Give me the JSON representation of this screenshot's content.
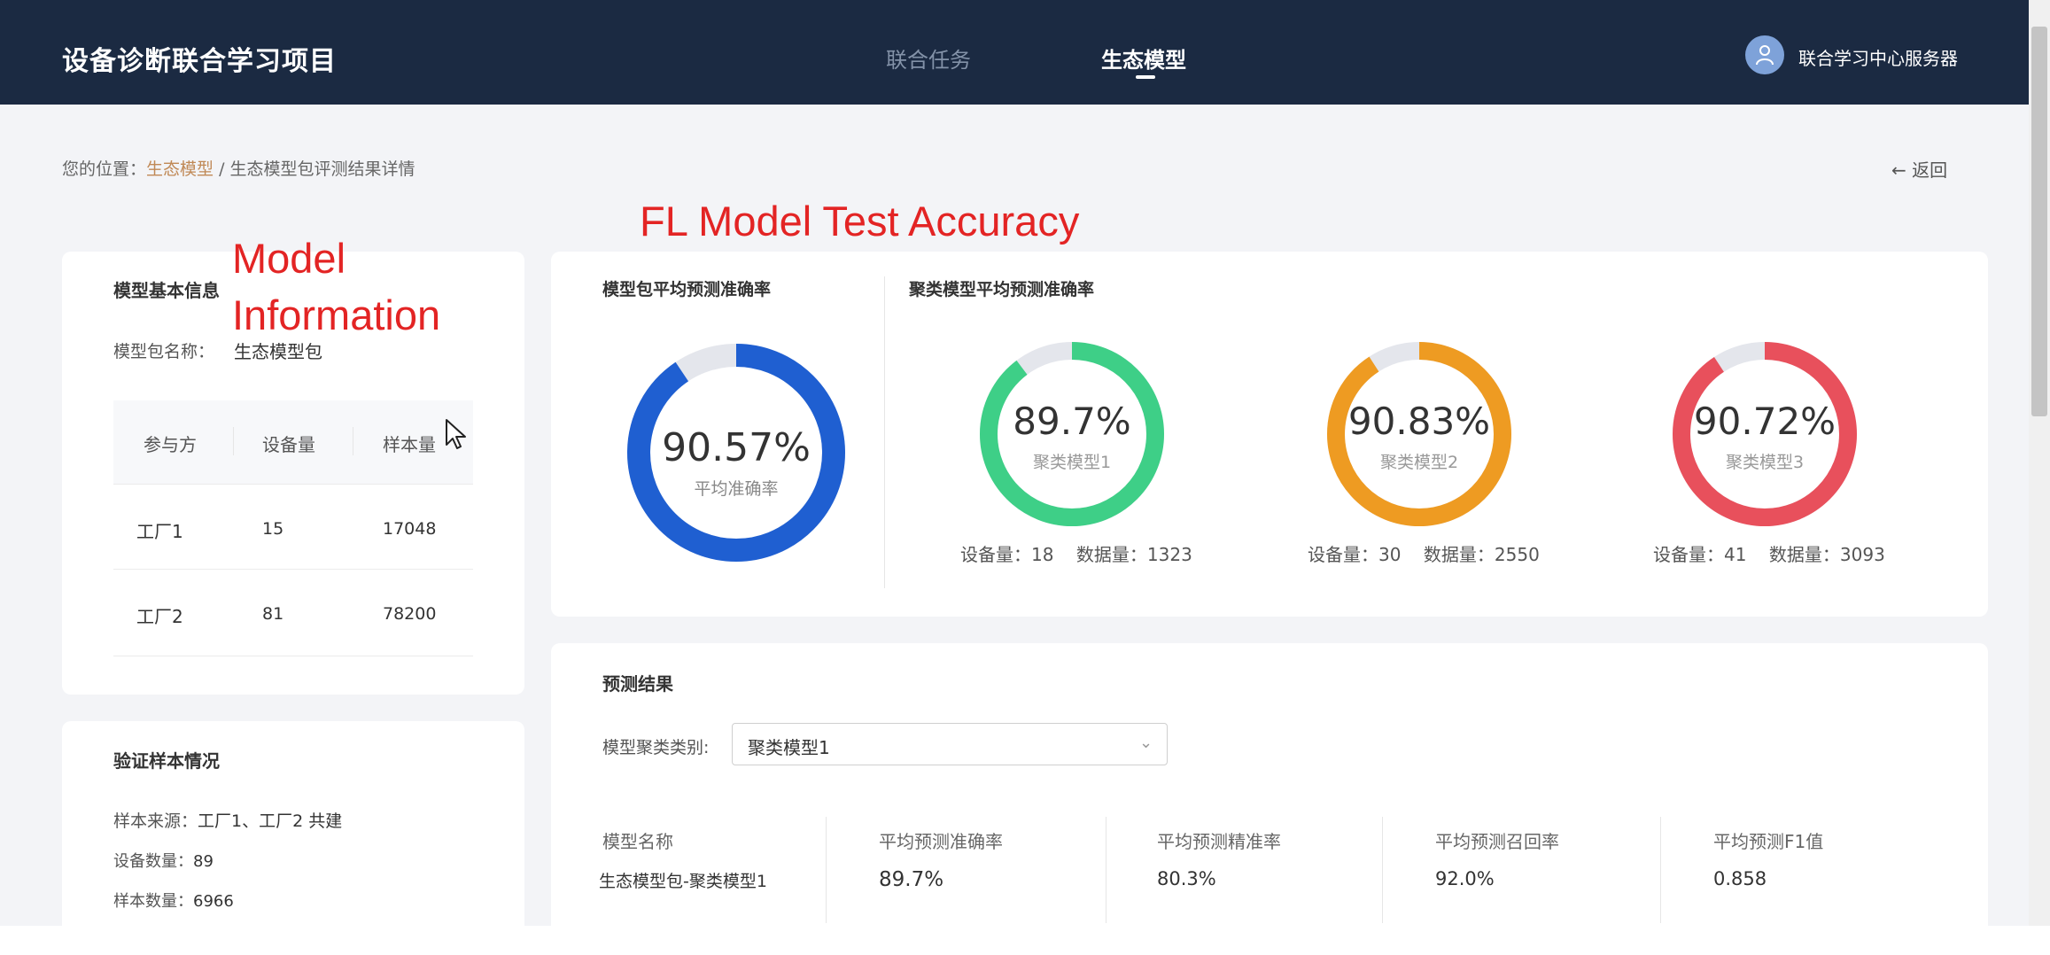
{
  "header": {
    "app_title": "设备诊断联合学习项目",
    "nav": [
      {
        "label": "联合任务",
        "active": false
      },
      {
        "label": "生态模型",
        "active": true
      }
    ],
    "user_name": "联合学习中心服务器"
  },
  "breadcrumb": {
    "prefix": "您的位置：",
    "link": "生态模型",
    "separator": "/",
    "current": "生态模型包评测结果详情"
  },
  "back_label": "← 返回",
  "annotations": {
    "fl_accuracy": "FL Model Test Accuracy",
    "model_info_line1": "Model",
    "model_info_line2": "Information"
  },
  "model_info": {
    "title": "模型基本信息",
    "package_name_label": "模型包名称：",
    "package_name": "生态模型包",
    "table": {
      "headers": [
        "参与方",
        "设备量",
        "样本量"
      ],
      "rows": [
        {
          "party": "工厂1",
          "devices": "15",
          "samples": "17048"
        },
        {
          "party": "工厂2",
          "devices": "81",
          "samples": "78200"
        }
      ]
    }
  },
  "validation": {
    "title": "验证样本情况",
    "source_label": "样本来源：",
    "source": "工厂1、工厂2 共建",
    "device_count_label": "设备数量：",
    "device_count": "89",
    "sample_count_label": "样本数量：",
    "sample_count": "6966"
  },
  "accuracy": {
    "package_title": "模型包平均预测准确率",
    "cluster_title": "聚类模型平均预测准确率",
    "package_gauge": {
      "value_text": "90.57%",
      "fraction": 0.9057,
      "label": "平均准确率",
      "color": "#1f5fd1"
    },
    "cluster_gauges": [
      {
        "value_text": "89.7%",
        "fraction": 0.897,
        "label": "聚类模型1",
        "color": "#3ecf87",
        "devices_label": "设备量：",
        "devices": "18",
        "data_label": "数据量：",
        "data": "1323"
      },
      {
        "value_text": "90.83%",
        "fraction": 0.9083,
        "label": "聚类模型2",
        "color": "#ee9b22",
        "devices_label": "设备量：",
        "devices": "30",
        "data_label": "数据量：",
        "data": "2550"
      },
      {
        "value_text": "90.72%",
        "fraction": 0.9072,
        "label": "聚类模型3",
        "color": "#e8505c",
        "devices_label": "设备量：",
        "devices": "41",
        "data_label": "数据量：",
        "data": "3093"
      }
    ],
    "track_color": "#e4e6ec"
  },
  "prediction": {
    "title": "预测结果",
    "category_label": "模型聚类类别:",
    "category_value": "聚类模型1",
    "columns": [
      "模型名称",
      "平均预测准确率",
      "平均预测精准率",
      "平均预测召回率",
      "平均预测F1值"
    ],
    "row": [
      "生态模型包-聚类模型1",
      "89.7%",
      "80.3%",
      "92.0%",
      "0.858"
    ]
  }
}
